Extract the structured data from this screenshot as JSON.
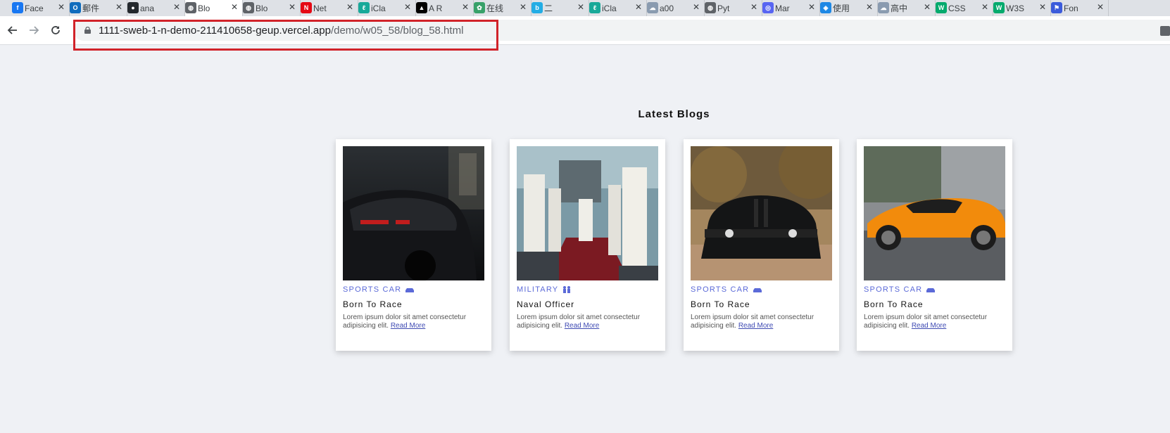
{
  "browser": {
    "tabs": [
      {
        "title": "Face",
        "icon": "facebook-icon",
        "color": "#1877f2",
        "glyph": "f"
      },
      {
        "title": "郵件",
        "icon": "outlook-icon",
        "color": "#0f6cbd",
        "glyph": "O"
      },
      {
        "title": "ana",
        "icon": "github-icon",
        "color": "#24292e",
        "glyph": "●"
      },
      {
        "title": "Blo",
        "icon": "globe-icon",
        "color": "#5f6368",
        "glyph": "◍"
      },
      {
        "title": "Blo",
        "icon": "globe-icon",
        "color": "#5f6368",
        "glyph": "◍"
      },
      {
        "title": "Net",
        "icon": "netflix-icon",
        "color": "#e50914",
        "glyph": "N"
      },
      {
        "title": "iCla",
        "icon": "iclass-icon",
        "color": "#18a999",
        "glyph": "ℓ"
      },
      {
        "title": "A R",
        "icon": "triangle-icon",
        "color": "#000000",
        "glyph": "▲"
      },
      {
        "title": "在线",
        "icon": "flower-icon",
        "color": "#38a169",
        "glyph": "✿"
      },
      {
        "title": "二",
        "icon": "bilibili-icon",
        "color": "#23ade5",
        "glyph": "b"
      },
      {
        "title": "iCla",
        "icon": "iclass-icon",
        "color": "#18a999",
        "glyph": "ℓ"
      },
      {
        "title": "a00",
        "icon": "cloud-icon",
        "color": "#8a9bb0",
        "glyph": "☁"
      },
      {
        "title": "Pyt",
        "icon": "globe-icon",
        "color": "#5f6368",
        "glyph": "◍"
      },
      {
        "title": "Mar",
        "icon": "discord-icon",
        "color": "#5865f2",
        "glyph": "◎"
      },
      {
        "title": "使用",
        "icon": "app-icon",
        "color": "#1e88e5",
        "glyph": "◈"
      },
      {
        "title": "高中",
        "icon": "cloud-icon",
        "color": "#8a9bb0",
        "glyph": "☁"
      },
      {
        "title": "CSS",
        "icon": "w3schools-icon",
        "color": "#04aa6d",
        "glyph": "W"
      },
      {
        "title": "W3S",
        "icon": "w3schools-icon",
        "color": "#04aa6d",
        "glyph": "W"
      },
      {
        "title": "Fon",
        "icon": "flag-icon",
        "color": "#3b5bdb",
        "glyph": "⚑"
      }
    ],
    "active_tab": 3,
    "url_host": "1111-sweb-1-n-demo-211410658-geup.vercel.app",
    "url_path": "/demo/w05_58/blog_58.html"
  },
  "page": {
    "heading": "Latest Blogs",
    "cards": [
      {
        "category": "SPORTS CAR",
        "category_icon": "car-icon",
        "title": "Born To Race",
        "body": "Lorem ipsum dolor sit amet consectetur adipisicing elit.",
        "link": "Read More",
        "image": "black-lamborghini-photo"
      },
      {
        "category": "MILITARY",
        "category_icon": "people-icon",
        "title": "Naval Officer",
        "body": "Lorem ipsum dolor sit amet consectetur adipisicing elit.",
        "link": "Read More",
        "image": "naval-officers-photo"
      },
      {
        "category": "SPORTS CAR",
        "category_icon": "car-icon",
        "title": "Born To Race",
        "body": "Lorem ipsum dolor sit amet consectetur adipisicing elit.",
        "link": "Read More",
        "image": "black-challenger-photo"
      },
      {
        "category": "SPORTS CAR",
        "category_icon": "car-icon",
        "title": "Born To Race",
        "body": "Lorem ipsum dolor sit amet consectetur adipisicing elit.",
        "link": "Read More",
        "image": "orange-lamborghini-photo"
      }
    ]
  },
  "colors": {
    "background": "#eff1f5",
    "category": "#5b6ad8",
    "link": "#3f4bb3",
    "highlight": "#d1232a"
  }
}
